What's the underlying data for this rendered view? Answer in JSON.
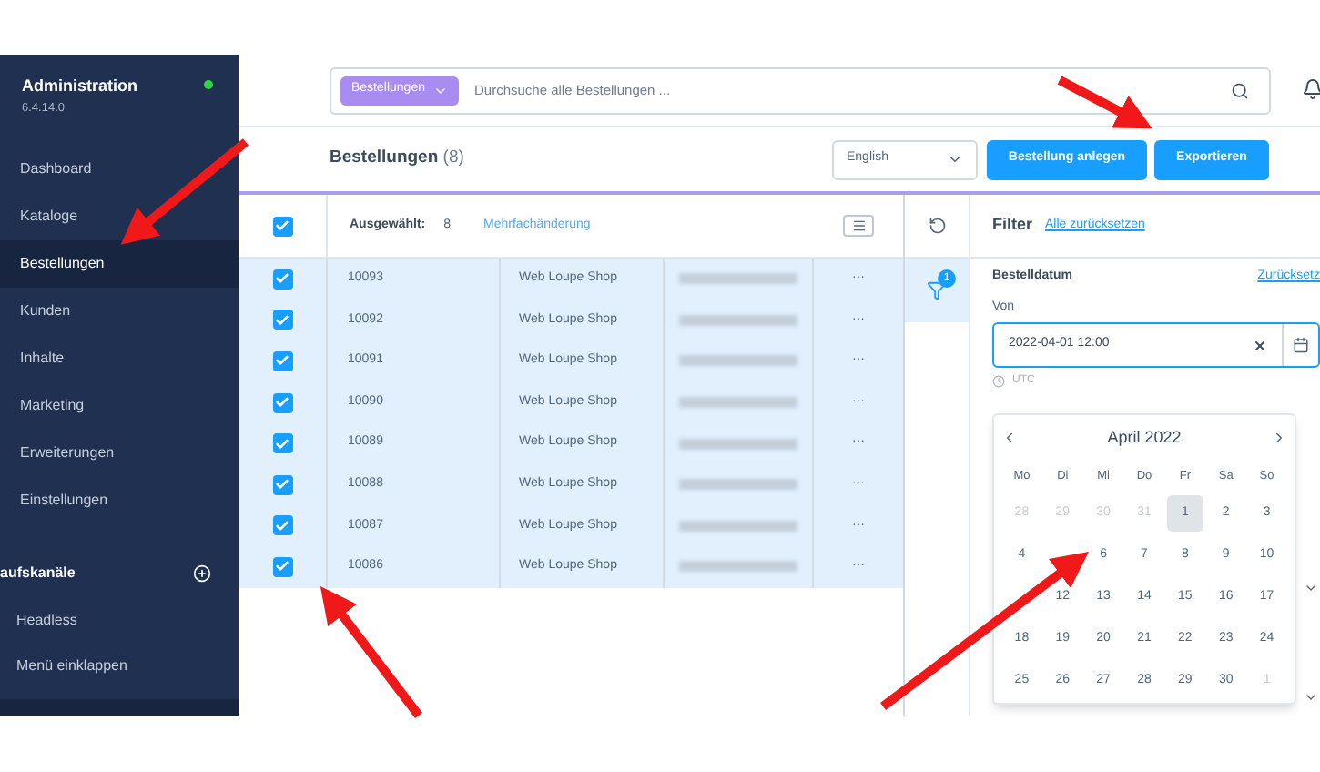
{
  "sidebar": {
    "title": "Administration",
    "version": "6.4.14.0",
    "online": true,
    "items": [
      {
        "label": "Dashboard",
        "selected": false
      },
      {
        "label": "Kataloge",
        "selected": false
      },
      {
        "label": "Bestellungen",
        "selected": true
      },
      {
        "label": "Kunden",
        "selected": false
      },
      {
        "label": "Inhalte",
        "selected": false
      },
      {
        "label": "Marketing",
        "selected": false
      },
      {
        "label": "Erweiterungen",
        "selected": false
      },
      {
        "label": "Einstellungen",
        "selected": false
      }
    ],
    "section": "aufskanäle",
    "channels": [
      "Headless",
      "Menü einklappen"
    ]
  },
  "search": {
    "scope": "Bestellungen",
    "placeholder": "Durchsuche alle Bestellungen ..."
  },
  "header": {
    "title": "Bestellungen",
    "count": "(8)",
    "language": "English",
    "buttons": [
      "Bestellung anlegen",
      "Exportieren"
    ]
  },
  "table": {
    "all_checked": true,
    "selected_label": "Ausgewählt:",
    "selected_count": "8",
    "bulk_link": "Mehrfachänderung",
    "rows": [
      {
        "number": "10093",
        "shop": "Web Loupe Shop",
        "checked": true,
        "actions": "···"
      },
      {
        "number": "10092",
        "shop": "Web Loupe Shop",
        "checked": true,
        "actions": "···"
      },
      {
        "number": "10091",
        "shop": "Web Loupe Shop",
        "checked": true,
        "actions": "···"
      },
      {
        "number": "10090",
        "shop": "Web Loupe Shop",
        "checked": true,
        "actions": "···"
      },
      {
        "number": "10089",
        "shop": "Web Loupe Shop",
        "checked": true,
        "actions": "···"
      },
      {
        "number": "10088",
        "shop": "Web Loupe Shop",
        "checked": true,
        "actions": "···"
      },
      {
        "number": "10087",
        "shop": "Web Loupe Shop",
        "checked": true,
        "actions": "···"
      },
      {
        "number": "10086",
        "shop": "Web Loupe Shop",
        "checked": true,
        "actions": "···"
      }
    ]
  },
  "filter": {
    "title": "Filter",
    "reset_all": "Alle zurücksetzen",
    "badge": "1",
    "field_title": "Bestelldatum",
    "reset": "Zurücksetz",
    "from_label": "Von",
    "from_value": "2022-04-01 12:00",
    "timezone": "UTC",
    "calendar": {
      "month": "April 2022",
      "weekdays": [
        "Mo",
        "Di",
        "Mi",
        "Do",
        "Fr",
        "Sa",
        "So"
      ],
      "weeks": [
        [
          {
            "kind": "day",
            "d": "28",
            "muted": true,
            "selected": false
          },
          {
            "kind": "day",
            "d": "29",
            "muted": true,
            "selected": false
          },
          {
            "kind": "day",
            "d": "30",
            "muted": true,
            "selected": false
          },
          {
            "kind": "day",
            "d": "31",
            "muted": true,
            "selected": false
          },
          {
            "kind": "day",
            "d": "1",
            "muted": false,
            "selected": true
          },
          {
            "kind": "day",
            "d": "2",
            "muted": false,
            "selected": false
          },
          {
            "kind": "day",
            "d": "3",
            "muted": false,
            "selected": false
          }
        ],
        [
          {
            "kind": "day",
            "d": "4",
            "muted": false,
            "selected": false
          },
          {
            "kind": "covered"
          },
          {
            "kind": "day",
            "d": "6",
            "muted": false,
            "selected": false
          },
          {
            "kind": "day",
            "d": "7",
            "muted": false,
            "selected": false
          },
          {
            "kind": "day",
            "d": "8",
            "muted": false,
            "selected": false
          },
          {
            "kind": "day",
            "d": "9",
            "muted": false,
            "selected": false
          },
          {
            "kind": "day",
            "d": "10",
            "muted": false,
            "selected": false
          }
        ],
        [
          {
            "kind": "covered"
          },
          {
            "kind": "day",
            "d": "12",
            "muted": false,
            "selected": false
          },
          {
            "kind": "day",
            "d": "13",
            "muted": false,
            "selected": false
          },
          {
            "kind": "day",
            "d": "14",
            "muted": false,
            "selected": false
          },
          {
            "kind": "day",
            "d": "15",
            "muted": false,
            "selected": false
          },
          {
            "kind": "day",
            "d": "16",
            "muted": false,
            "selected": false
          },
          {
            "kind": "day",
            "d": "17",
            "muted": false,
            "selected": false
          }
        ],
        [
          {
            "kind": "day",
            "d": "18",
            "muted": false,
            "selected": false
          },
          {
            "kind": "day",
            "d": "19",
            "muted": false,
            "selected": false
          },
          {
            "kind": "day",
            "d": "20",
            "muted": false,
            "selected": false
          },
          {
            "kind": "day",
            "d": "21",
            "muted": false,
            "selected": false
          },
          {
            "kind": "day",
            "d": "22",
            "muted": false,
            "selected": false
          },
          {
            "kind": "day",
            "d": "23",
            "muted": false,
            "selected": false
          },
          {
            "kind": "day",
            "d": "24",
            "muted": false,
            "selected": false
          }
        ],
        [
          {
            "kind": "day",
            "d": "25",
            "muted": false,
            "selected": false
          },
          {
            "kind": "day",
            "d": "26",
            "muted": false,
            "selected": false
          },
          {
            "kind": "day",
            "d": "27",
            "muted": false,
            "selected": false
          },
          {
            "kind": "day",
            "d": "28",
            "muted": false,
            "selected": false
          },
          {
            "kind": "day",
            "d": "29",
            "muted": false,
            "selected": false
          },
          {
            "kind": "day",
            "d": "30",
            "muted": false,
            "selected": false
          },
          {
            "kind": "day",
            "d": "1",
            "muted": true,
            "selected": false
          }
        ]
      ]
    }
  }
}
